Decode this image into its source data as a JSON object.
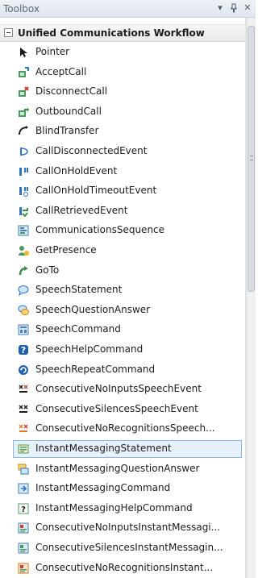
{
  "window": {
    "title": "Toolbox",
    "dropdown_glyph": "▾",
    "pin_glyph": "ᵖ",
    "close_glyph": "✕"
  },
  "category": {
    "label": "Unified Communications Workflow",
    "expanded": true
  },
  "items": [
    {
      "label": "Pointer",
      "icon": "pointer-arrow-icon"
    },
    {
      "label": "AcceptCall",
      "icon": "accept-call-icon"
    },
    {
      "label": "DisconnectCall",
      "icon": "disconnect-call-icon"
    },
    {
      "label": "OutboundCall",
      "icon": "outbound-call-icon"
    },
    {
      "label": "BlindTransfer",
      "icon": "blind-transfer-icon"
    },
    {
      "label": "CallDisconnectedEvent",
      "icon": "call-disconnected-event-icon"
    },
    {
      "label": "CallOnHoldEvent",
      "icon": "call-on-hold-event-icon"
    },
    {
      "label": "CallOnHoldTimeoutEvent",
      "icon": "call-on-hold-timeout-event-icon"
    },
    {
      "label": "CallRetrievedEvent",
      "icon": "call-retrieved-event-icon"
    },
    {
      "label": "CommunicationsSequence",
      "icon": "communications-sequence-icon"
    },
    {
      "label": "GetPresence",
      "icon": "get-presence-icon"
    },
    {
      "label": "GoTo",
      "icon": "goto-icon"
    },
    {
      "label": "SpeechStatement",
      "icon": "speech-statement-icon"
    },
    {
      "label": "SpeechQuestionAnswer",
      "icon": "speech-question-answer-icon"
    },
    {
      "label": "SpeechCommand",
      "icon": "speech-command-icon"
    },
    {
      "label": "SpeechHelpCommand",
      "icon": "speech-help-command-icon"
    },
    {
      "label": "SpeechRepeatCommand",
      "icon": "speech-repeat-command-icon"
    },
    {
      "label": "ConsecutiveNoInputsSpeechEvent",
      "icon": "consecutive-no-inputs-speech-event-icon"
    },
    {
      "label": "ConsecutiveSilencesSpeechEvent",
      "icon": "consecutive-silences-speech-event-icon"
    },
    {
      "label": "ConsecutiveNoRecognitionsSpeech...",
      "icon": "consecutive-no-recognitions-speech-icon"
    },
    {
      "label": "InstantMessagingStatement",
      "icon": "instant-messaging-statement-icon",
      "selected": true
    },
    {
      "label": "InstantMessagingQuestionAnswer",
      "icon": "instant-messaging-question-answer-icon"
    },
    {
      "label": "InstantMessagingCommand",
      "icon": "instant-messaging-command-icon"
    },
    {
      "label": "InstantMessagingHelpCommand",
      "icon": "instant-messaging-help-command-icon"
    },
    {
      "label": "ConsecutiveNoInputsInstantMessagi...",
      "icon": "consecutive-no-inputs-im-icon"
    },
    {
      "label": "ConsecutiveSilencesInstantMessagin...",
      "icon": "consecutive-silences-im-icon"
    },
    {
      "label": "ConsecutiveNoRecognitionsInstant...",
      "icon": "consecutive-no-recognitions-im-icon"
    }
  ],
  "colors": {
    "selection_bg": "#e6f1fb",
    "selection_border": "#8cb8e0",
    "title_text": "#5f6b7a"
  }
}
